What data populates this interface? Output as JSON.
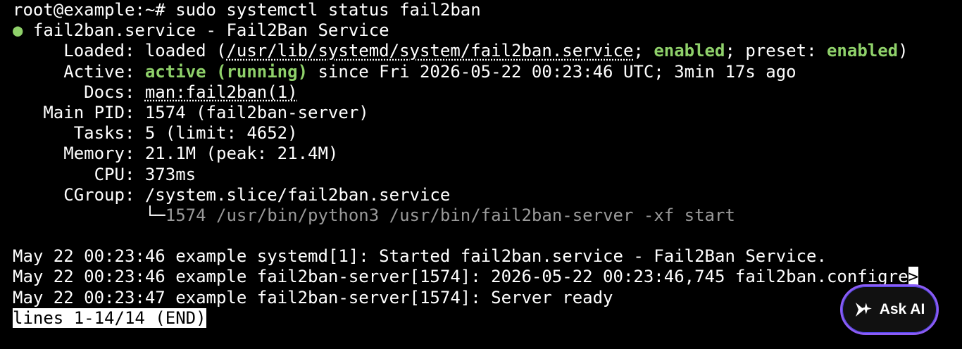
{
  "terminal": {
    "prompt": "root@example:~# sudo systemctl status fail2ban",
    "service_dot": "●",
    "service_title": " fail2ban.service - Fail2Ban Service",
    "loaded_label": "     Loaded: ",
    "loaded_prefix": "loaded (",
    "loaded_path": "/usr/lib/systemd/system/fail2ban.service",
    "loaded_sep1": "; ",
    "loaded_enabled": "enabled",
    "loaded_sep2": "; preset: ",
    "loaded_preset": "enabled",
    "loaded_suffix": ")",
    "active_label": "     Active: ",
    "active_state": "active (running)",
    "active_since": " since Fri 2026-05-22 00:23:46 UTC; 3min 17s ago",
    "docs_label": "       Docs: ",
    "docs_value": "man:fail2ban(1)",
    "pid_label": "   Main PID: ",
    "pid_value": "1574 (fail2ban-server)",
    "tasks_label": "      Tasks: ",
    "tasks_value": "5 (limit: 4652)",
    "memory_label": "     Memory: ",
    "memory_value": "21.1M (peak: 21.4M)",
    "cpu_label": "        CPU: ",
    "cpu_value": "373ms",
    "cgroup_label": "     CGroup: ",
    "cgroup_value": "/system.slice/fail2ban.service",
    "tree_prefix": "             └─",
    "tree_value": "1574 /usr/bin/python3 /usr/bin/fail2ban-server -xf start",
    "log_lines": [
      "May 22 00:23:46 example systemd[1]: Started fail2ban.service - Fail2Ban Service.",
      "May 22 00:23:46 example fail2ban-server[1574]: 2026-05-22 00:23:46,745 fail2ban.configre",
      "May 22 00:23:47 example fail2ban-server[1574]: Server ready"
    ],
    "truncation_marker": ">",
    "pager_status": "lines 1-14/14 (END)"
  },
  "ask_ai": {
    "label": "Ask AI",
    "icon": "sparkle-arrow-icon",
    "border_color": "#8b5cf6"
  },
  "colors": {
    "background": "#000000",
    "text": "#ffffff",
    "accent_green": "#8fd16a",
    "dim_gray": "#9a9a9a"
  }
}
